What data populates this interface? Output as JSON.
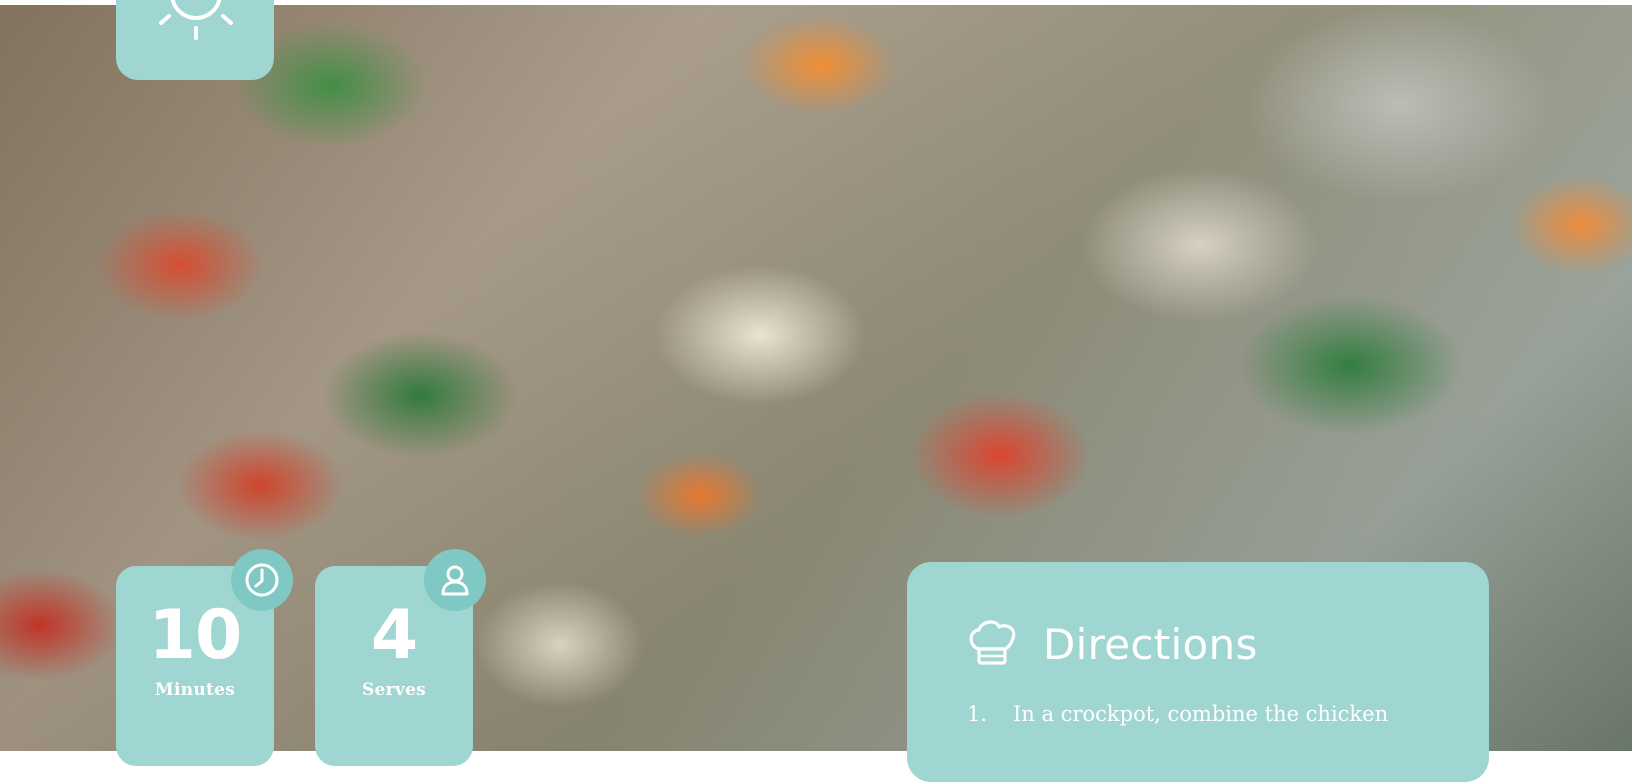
{
  "hero": {
    "image_subject": "vegetable soup with kale, carrots, tomatoes and beans"
  },
  "logo": {
    "icon": "sun-icon"
  },
  "stats": {
    "time": {
      "value": "10",
      "label": "Minutes",
      "icon": "clock-icon"
    },
    "serves": {
      "value": "4",
      "label": "Serves",
      "icon": "person-icon"
    }
  },
  "directions": {
    "title": "Directions",
    "icon": "chef-hat-icon",
    "steps": [
      {
        "number": "1.",
        "text": "In a crockpot, combine the chicken"
      }
    ]
  },
  "colors": {
    "card": "#9fd6d2",
    "badge": "#7fc8c3",
    "text": "#ffffff"
  }
}
